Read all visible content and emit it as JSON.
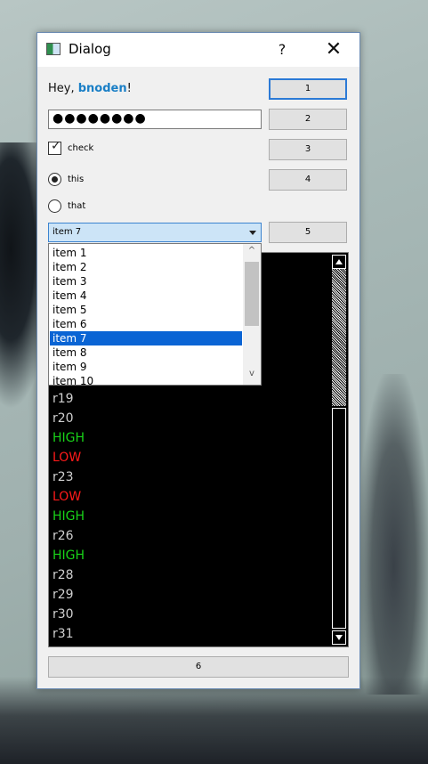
{
  "window": {
    "title": "Dialog",
    "help_label": "?",
    "close_label": "✕"
  },
  "greeting": {
    "prefix": "Hey, ",
    "username": "bnoden",
    "suffix": "!"
  },
  "password": {
    "value": "●●●●●●●●"
  },
  "checkbox": {
    "label": "check",
    "checked": true,
    "mark": "✓"
  },
  "radios": [
    {
      "label": "this",
      "selected": true
    },
    {
      "label": "that",
      "selected": false
    }
  ],
  "combo": {
    "selected": "item 7"
  },
  "buttons": {
    "b1": "1",
    "b2": "2",
    "b3": "3",
    "b4": "4",
    "b5": "5",
    "b6": "6"
  },
  "dropdown": {
    "items": [
      "item 1",
      "item 2",
      "item 3",
      "item 4",
      "item 5",
      "item 6",
      "item 7",
      "item 8",
      "item 9",
      "item 10"
    ],
    "selected_index": 6,
    "scroll_up": "^",
    "scroll_down": "v"
  },
  "console": {
    "lines": [
      {
        "text": "r19",
        "color": "#d0d0d0"
      },
      {
        "text": "r20",
        "color": "#d0d0d0"
      },
      {
        "text": "HIGH",
        "color": "#19d319"
      },
      {
        "text": "LOW",
        "color": "#ff1a1a"
      },
      {
        "text": "r23",
        "color": "#d0d0d0"
      },
      {
        "text": "LOW",
        "color": "#ff1a1a"
      },
      {
        "text": "HIGH",
        "color": "#19d319"
      },
      {
        "text": "r26",
        "color": "#d0d0d0"
      },
      {
        "text": "HIGH",
        "color": "#19d319"
      },
      {
        "text": "r28",
        "color": "#d0d0d0"
      },
      {
        "text": "r29",
        "color": "#d0d0d0"
      },
      {
        "text": "r30",
        "color": "#d0d0d0"
      },
      {
        "text": "r31",
        "color": "#d0d0d0"
      }
    ]
  },
  "colors": {
    "accent": "#1a7fc6",
    "selection": "#0a64d4",
    "focus_border": "#2c7ad6"
  }
}
